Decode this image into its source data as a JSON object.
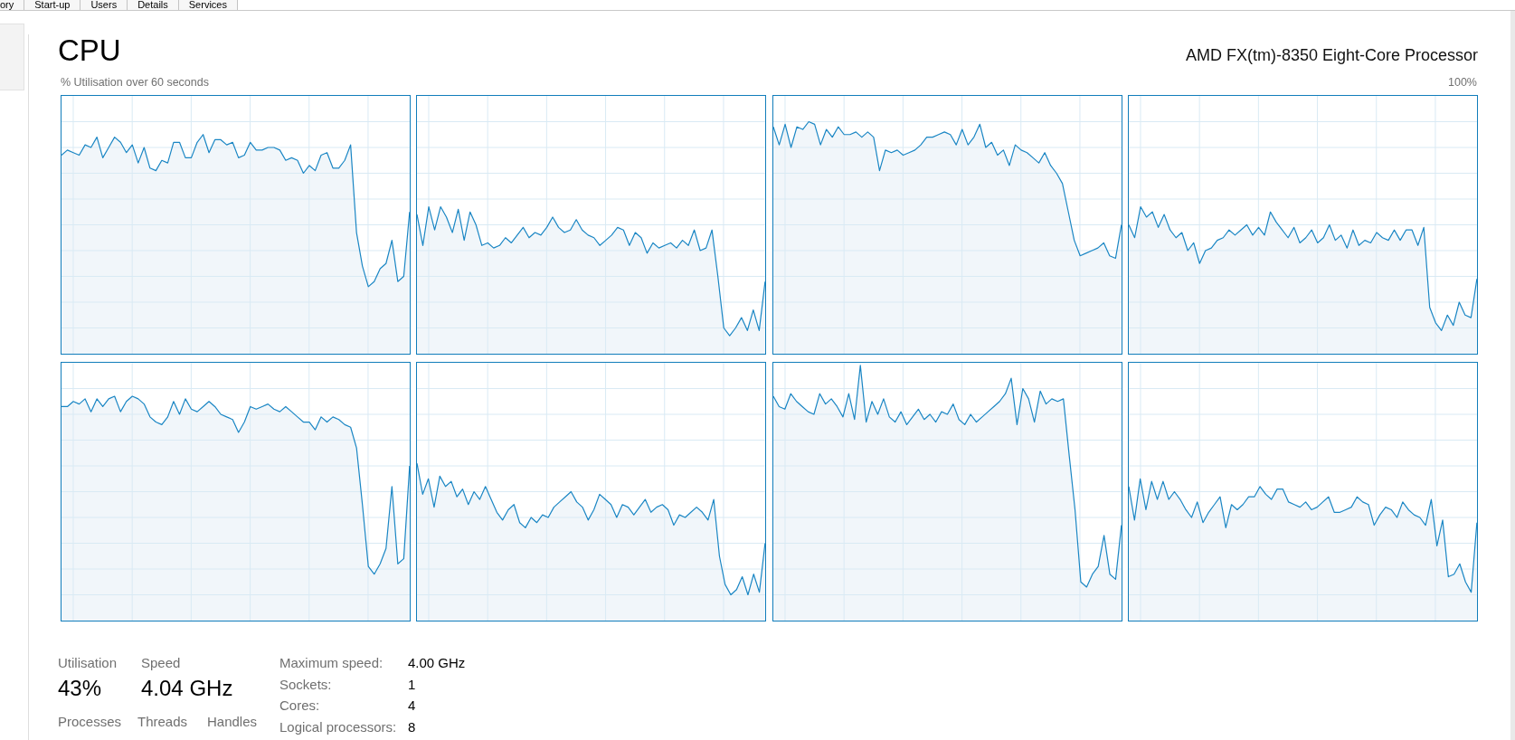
{
  "tabs": [
    {
      "label": "ory",
      "selected": false
    },
    {
      "label": "Start-up",
      "selected": false
    },
    {
      "label": "Users",
      "selected": false
    },
    {
      "label": "Details",
      "selected": false
    },
    {
      "label": "Services",
      "selected": false
    }
  ],
  "sidebar": {
    "items": [
      {
        "selected": true
      }
    ]
  },
  "header": {
    "title": "CPU",
    "processor": "AMD FX(tm)-8350 Eight-Core Processor"
  },
  "graph": {
    "caption": "% Utilisation over 60 seconds",
    "max_label": "100%"
  },
  "stats": [
    {
      "label": "Utilisation",
      "value": "43%"
    },
    {
      "label": "Speed",
      "value": "4.04 GHz"
    }
  ],
  "counts": [
    "Processes",
    "Threads",
    "Handles"
  ],
  "specs": [
    {
      "label": "Maximum speed:",
      "value": "4.00 GHz"
    },
    {
      "label": "Sockets:",
      "value": "1"
    },
    {
      "label": "Cores:",
      "value": "4"
    },
    {
      "label": "Logical processors:",
      "value": "8"
    }
  ]
}
